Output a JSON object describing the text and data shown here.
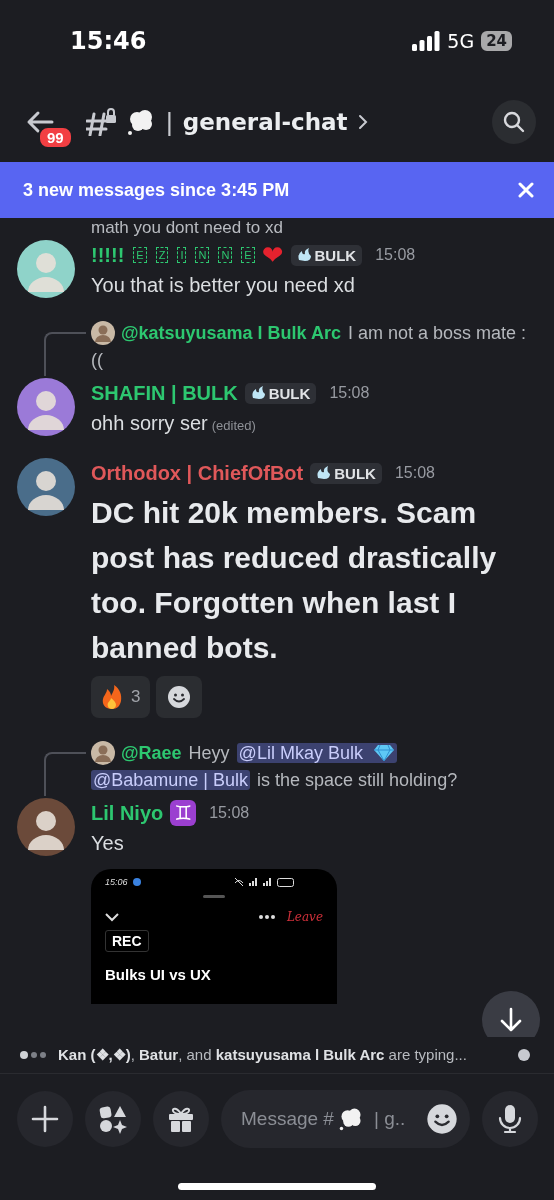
{
  "status_bar": {
    "time": "15:46",
    "network": "5G",
    "battery": "24"
  },
  "header": {
    "badge": "99",
    "separator": "|",
    "channel": "general-chat"
  },
  "banner": {
    "text": "3 new messages since 3:45 PM"
  },
  "messages": [
    {
      "kind": "tail",
      "text": "math you dont need to xd"
    },
    {
      "kind": "message",
      "author": "!!!!!",
      "boxed_letters": [
        "E",
        "Z",
        "I",
        "N",
        "N",
        "E"
      ],
      "color": "#2dc770",
      "decoration": "❤",
      "tag": "BULK",
      "time": "15:08",
      "text": "You that is better you need xd"
    },
    {
      "kind": "message",
      "reply": {
        "author": "@katsuyusama l Bulk Arc",
        "color": "#2dc770",
        "segments": [
          {
            "kind": "text",
            "text": "I am not a boss mate : (("
          }
        ]
      },
      "author": "SHAFIN | BULK",
      "color": "#2dc770",
      "tag": "BULK",
      "time": "15:08",
      "text": "ohh sorry ser",
      "edited": "(edited)"
    },
    {
      "kind": "message",
      "author": "Orthodox | ChiefOfBot",
      "color": "#e0585a",
      "tag": "BULK",
      "time": "15:08",
      "text": "DC hit 20k members. Scam post has reduced drastically too. Forgotten when last I banned bots.",
      "large": true,
      "reactions": [
        {
          "count": "3"
        }
      ]
    },
    {
      "kind": "message",
      "reply": {
        "author": "@Raee",
        "color": "#2dc770",
        "segments": [
          {
            "kind": "text",
            "text": "Heyy"
          },
          {
            "kind": "mention_gem",
            "text": "@Lil Mkay Bulk"
          },
          {
            "kind": "mention",
            "text": "@Babamune | Bulk"
          },
          {
            "kind": "text",
            "text": "is the space still holding?"
          }
        ]
      },
      "author": "Lil Niyo",
      "color": "#2dc770",
      "decoration": "♊",
      "time": "15:08",
      "text": "Yes",
      "attachment": {
        "time": "15:06",
        "action": "Leave",
        "badge": "REC",
        "title": "Bulks UI vs UX"
      }
    }
  ],
  "typing": {
    "text": "**Kan  (❖,❖)**, **Batur**, and **katsuyusama l Bulk Arc** are typing..."
  },
  "composer": {
    "placeholder": {
      "before": "Message #",
      "after": "| g.."
    }
  }
}
